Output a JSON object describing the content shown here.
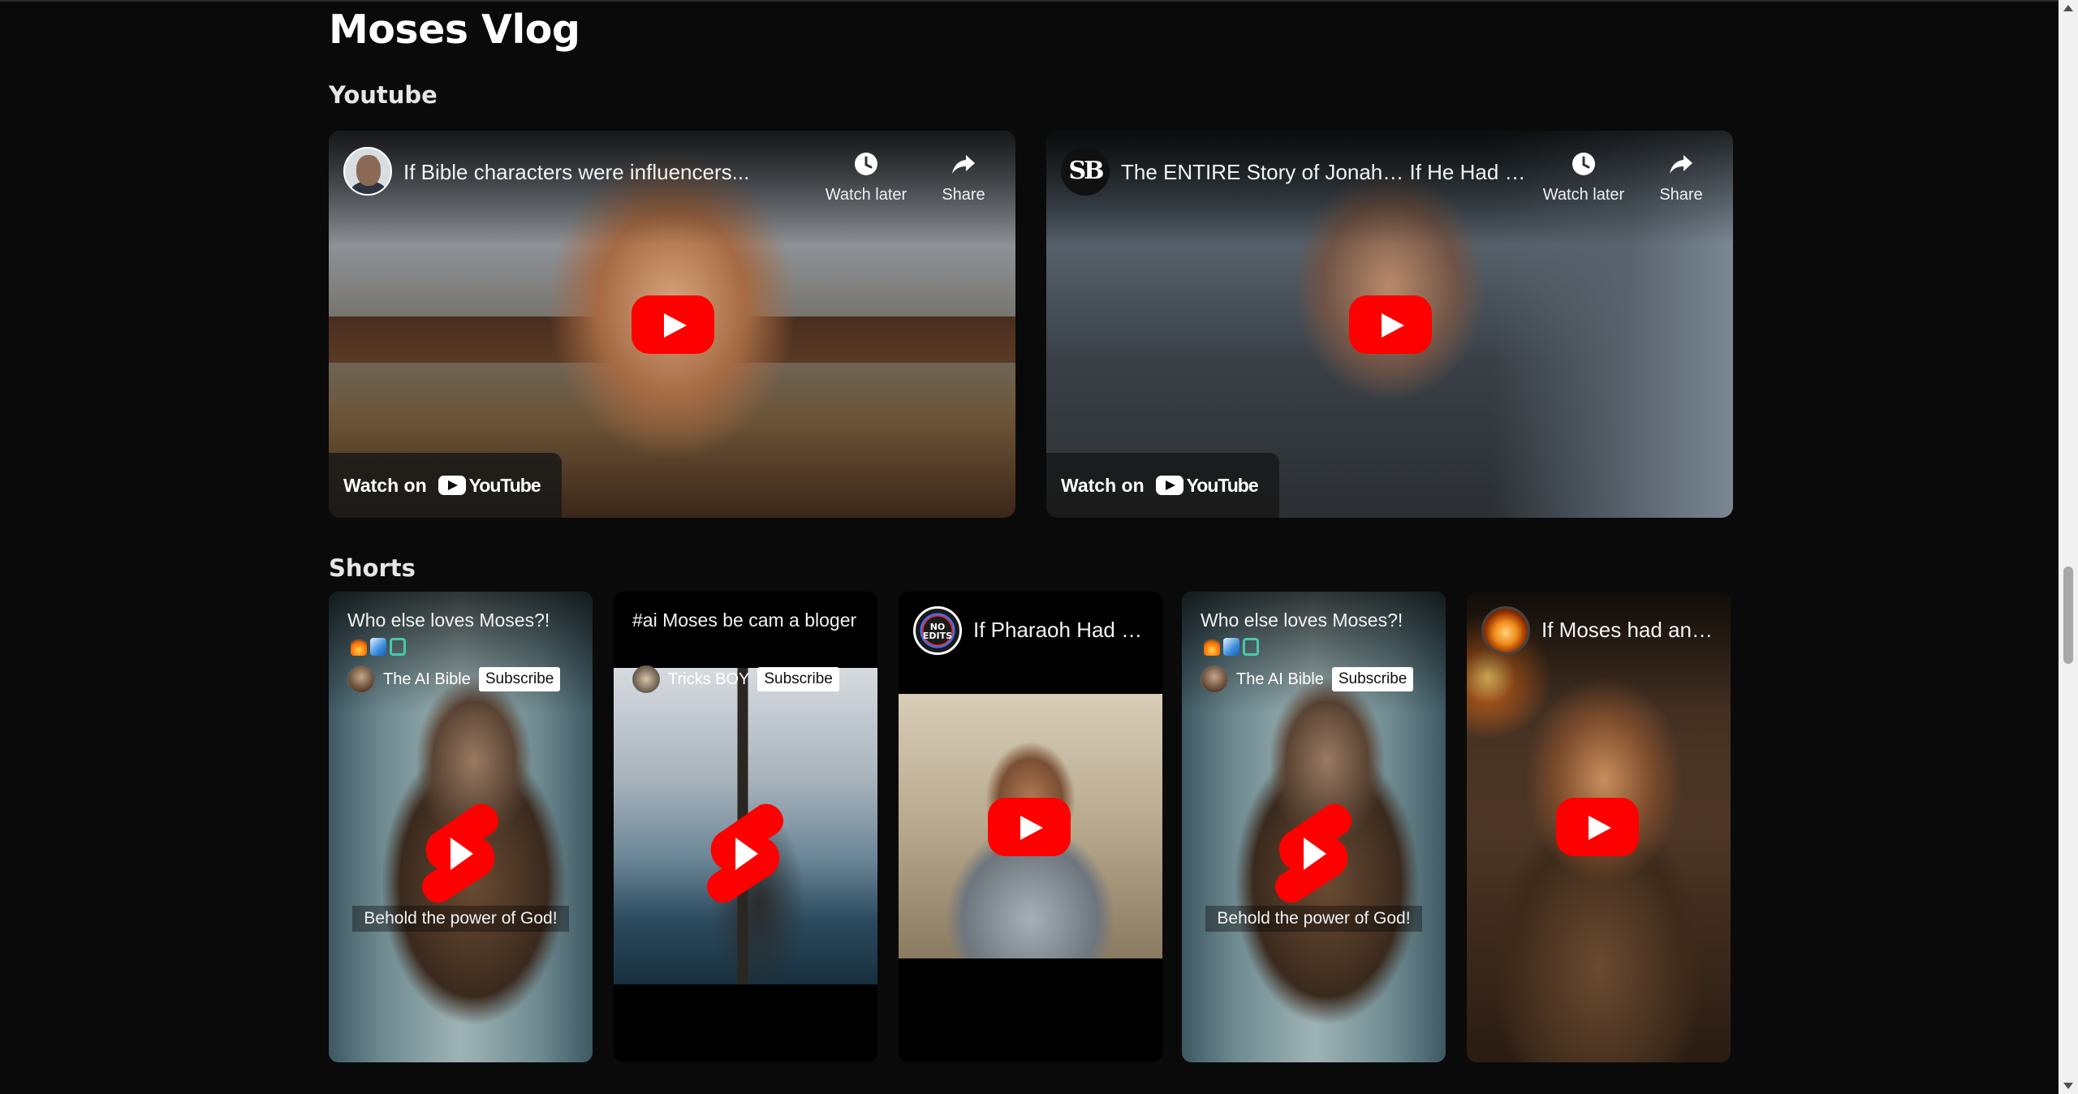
{
  "page": {
    "title": "Moses Vlog"
  },
  "sections": {
    "youtube": "Youtube",
    "shorts": "Shorts"
  },
  "videos": [
    {
      "title": "If Bible characters were influencers...",
      "watch_later": "Watch later",
      "share": "Share",
      "watch_on": "Watch on",
      "brand": "YouTube"
    },
    {
      "title": "The ENTIRE Story of Jonah… If He Had …",
      "channel_initials": "SB",
      "watch_later": "Watch later",
      "share": "Share",
      "watch_on": "Watch on",
      "brand": "YouTube"
    }
  ],
  "shorts": [
    {
      "title": "Who else loves Moses?!",
      "channel": "The AI Bible",
      "subscribe": "Subscribe",
      "caption": "Behold the power of God!"
    },
    {
      "title": "#ai Moses be cam a bloger",
      "channel": "Tricks BOY",
      "subscribe": "Subscribe"
    },
    {
      "title": "If Pharaoh Had …",
      "avatar_text": "NO EDITS"
    },
    {
      "title": "Who else loves Moses?!",
      "channel": "The AI Bible",
      "subscribe": "Subscribe",
      "caption": "Behold the power of God!"
    },
    {
      "title": "If Moses had an…"
    }
  ],
  "colors": {
    "background": "#0a0a0a",
    "youtube_red": "#ff0000",
    "text": "#ffffff"
  },
  "icons": [
    "clock-icon",
    "share-arrow-icon",
    "youtube-play-icon",
    "youtube-shorts-icon"
  ]
}
